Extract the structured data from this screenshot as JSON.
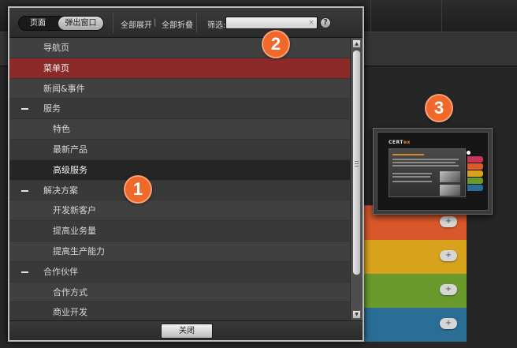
{
  "toolbar": {
    "tab_pages": "页面",
    "tab_popups": "弹出窗口",
    "expand_all": "全部展开",
    "separator": "|",
    "collapse_all": "全部折叠",
    "filter_label": "筛选:",
    "filter_value": "",
    "clear_icon": "×",
    "help_label": "?"
  },
  "tree": {
    "items": [
      {
        "label": "导航页",
        "level": 1,
        "expander": false,
        "state": "normal"
      },
      {
        "label": "菜单页",
        "level": 1,
        "expander": false,
        "state": "selected"
      },
      {
        "label": "新闻&事件",
        "level": 1,
        "expander": false,
        "state": "normal"
      },
      {
        "label": "服务",
        "level": 1,
        "expander": true,
        "state": "normal"
      },
      {
        "label": "特色",
        "level": 2,
        "expander": false,
        "state": "normal"
      },
      {
        "label": "最新产品",
        "level": 2,
        "expander": false,
        "state": "normal"
      },
      {
        "label": "高级服务",
        "level": 2,
        "expander": false,
        "state": "highlight"
      },
      {
        "label": "解决方案",
        "level": 1,
        "expander": true,
        "state": "normal"
      },
      {
        "label": "开发新客户",
        "level": 2,
        "expander": false,
        "state": "normal"
      },
      {
        "label": "提高业务量",
        "level": 2,
        "expander": false,
        "state": "normal"
      },
      {
        "label": "提高生产能力",
        "level": 2,
        "expander": false,
        "state": "normal"
      },
      {
        "label": "合作伙伴",
        "level": 1,
        "expander": true,
        "state": "normal"
      },
      {
        "label": "合作方式",
        "level": 2,
        "expander": false,
        "state": "normal"
      },
      {
        "label": "商业开发",
        "level": 2,
        "expander": false,
        "state": "normal"
      }
    ]
  },
  "footer": {
    "close_label": "关闭"
  },
  "callouts": {
    "one": "1",
    "two": "2",
    "three": "3"
  },
  "thumbnail": {
    "logo_text": "CERT",
    "logo_accent": "ex"
  },
  "colors": {
    "accent_orange": "#f0682a",
    "selected_row": "#8c2a2a",
    "bands": [
      "#c2365c",
      "#e0582a",
      "#d89a1c",
      "#6c9a2a",
      "#2a6f96"
    ]
  }
}
